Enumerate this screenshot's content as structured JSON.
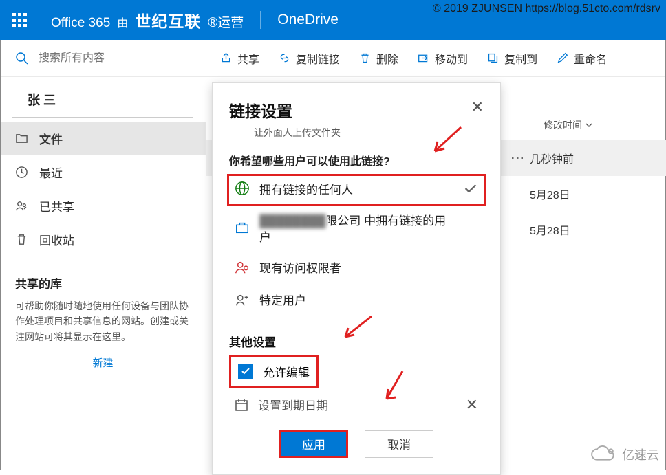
{
  "watermark_top": "© 2019 ZJUNSEN https://blog.51cto.com/rdsrv",
  "watermark_bottom": "亿速云",
  "header": {
    "office": "Office 365",
    "by": "由",
    "operator": "世纪互联",
    "tag": "®运营",
    "app": "OneDrive"
  },
  "search": {
    "placeholder": "搜索所有内容"
  },
  "actions": {
    "share": "共享",
    "copylink": "复制链接",
    "delete": "删除",
    "moveto": "移动到",
    "copyto": "复制到",
    "rename": "重命名"
  },
  "sidebar": {
    "user": "张 三",
    "items": [
      {
        "label": "文件"
      },
      {
        "label": "最近"
      },
      {
        "label": "已共享"
      },
      {
        "label": "回收站"
      }
    ],
    "lib_title": "共享的库",
    "lib_desc": "可帮助你随时随地使用任何设备与团队协作处理项目和共享信息的网站。创建或关注网站可将其显示在这里。",
    "new": "新建"
  },
  "list": {
    "col_modified": "修改时间",
    "items": [
      {
        "date": "几秒钟前",
        "selected": true
      },
      {
        "date": "5月28日",
        "selected": false
      },
      {
        "date": "5月28日",
        "selected": false
      }
    ]
  },
  "panel": {
    "title": "链接设置",
    "subtitle": "让外面人上传文件夹",
    "q": "你希望哪些用户可以使用此链接?",
    "opts": [
      {
        "label": "拥有链接的任何人"
      },
      {
        "label_suffix": "限公司 中拥有链接的用户"
      },
      {
        "label": "现有访问权限者"
      },
      {
        "label": "特定用户"
      }
    ],
    "other_title": "其他设置",
    "allow_edit": "允许编辑",
    "set_expiry": "设置到期日期",
    "apply": "应用",
    "cancel": "取消"
  }
}
